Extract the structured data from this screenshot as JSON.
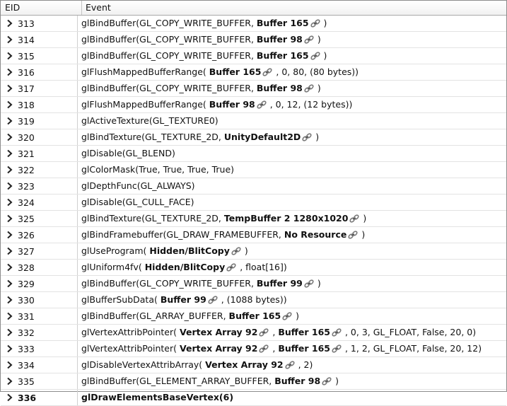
{
  "columns": {
    "eid": "EID",
    "event": "Event"
  },
  "rows": [
    {
      "eid": "313",
      "parts": [
        {
          "t": "glBindBuffer(GL_COPY_WRITE_BUFFER, "
        },
        {
          "t": "Buffer 165",
          "b": true,
          "l": true
        },
        {
          "t": " )"
        }
      ]
    },
    {
      "eid": "314",
      "parts": [
        {
          "t": "glBindBuffer(GL_COPY_WRITE_BUFFER, "
        },
        {
          "t": "Buffer 98",
          "b": true,
          "l": true
        },
        {
          "t": " )"
        }
      ]
    },
    {
      "eid": "315",
      "parts": [
        {
          "t": "glBindBuffer(GL_COPY_WRITE_BUFFER, "
        },
        {
          "t": "Buffer 165",
          "b": true,
          "l": true
        },
        {
          "t": " )"
        }
      ]
    },
    {
      "eid": "316",
      "parts": [
        {
          "t": "glFlushMappedBufferRange( "
        },
        {
          "t": "Buffer 165",
          "b": true,
          "l": true
        },
        {
          "t": " , 0, 80, (80 bytes))"
        }
      ]
    },
    {
      "eid": "317",
      "parts": [
        {
          "t": "glBindBuffer(GL_COPY_WRITE_BUFFER, "
        },
        {
          "t": "Buffer 98",
          "b": true,
          "l": true
        },
        {
          "t": " )"
        }
      ]
    },
    {
      "eid": "318",
      "parts": [
        {
          "t": "glFlushMappedBufferRange( "
        },
        {
          "t": "Buffer 98",
          "b": true,
          "l": true
        },
        {
          "t": " , 0, 12, (12 bytes))"
        }
      ]
    },
    {
      "eid": "319",
      "parts": [
        {
          "t": "glActiveTexture(GL_TEXTURE0)"
        }
      ]
    },
    {
      "eid": "320",
      "parts": [
        {
          "t": "glBindTexture(GL_TEXTURE_2D, "
        },
        {
          "t": "UnityDefault2D",
          "b": true,
          "l": true
        },
        {
          "t": " )"
        }
      ]
    },
    {
      "eid": "321",
      "parts": [
        {
          "t": "glDisable(GL_BLEND)"
        }
      ]
    },
    {
      "eid": "322",
      "parts": [
        {
          "t": "glColorMask(True, True, True, True)"
        }
      ]
    },
    {
      "eid": "323",
      "parts": [
        {
          "t": "glDepthFunc(GL_ALWAYS)"
        }
      ]
    },
    {
      "eid": "324",
      "parts": [
        {
          "t": "glDisable(GL_CULL_FACE)"
        }
      ]
    },
    {
      "eid": "325",
      "parts": [
        {
          "t": "glBindTexture(GL_TEXTURE_2D, "
        },
        {
          "t": "TempBuffer 2 1280x1020",
          "b": true,
          "l": true
        },
        {
          "t": " )"
        }
      ]
    },
    {
      "eid": "326",
      "parts": [
        {
          "t": "glBindFramebuffer(GL_DRAW_FRAMEBUFFER, "
        },
        {
          "t": "No Resource",
          "b": true,
          "l": true
        },
        {
          "t": " )"
        }
      ]
    },
    {
      "eid": "327",
      "parts": [
        {
          "t": "glUseProgram( "
        },
        {
          "t": "Hidden/BlitCopy",
          "b": true,
          "l": true
        },
        {
          "t": " )"
        }
      ]
    },
    {
      "eid": "328",
      "parts": [
        {
          "t": "glUniform4fv( "
        },
        {
          "t": "Hidden/BlitCopy",
          "b": true,
          "l": true
        },
        {
          "t": " , float[16])"
        }
      ]
    },
    {
      "eid": "329",
      "parts": [
        {
          "t": "glBindBuffer(GL_COPY_WRITE_BUFFER, "
        },
        {
          "t": "Buffer 99",
          "b": true,
          "l": true
        },
        {
          "t": " )"
        }
      ]
    },
    {
      "eid": "330",
      "parts": [
        {
          "t": "glBufferSubData( "
        },
        {
          "t": "Buffer 99",
          "b": true,
          "l": true
        },
        {
          "t": " , (1088 bytes))"
        }
      ]
    },
    {
      "eid": "331",
      "parts": [
        {
          "t": "glBindBuffer(GL_ARRAY_BUFFER, "
        },
        {
          "t": "Buffer 165",
          "b": true,
          "l": true
        },
        {
          "t": " )"
        }
      ]
    },
    {
      "eid": "332",
      "parts": [
        {
          "t": "glVertexAttribPointer( "
        },
        {
          "t": "Vertex Array 92",
          "b": true,
          "l": true
        },
        {
          "t": " , "
        },
        {
          "t": "Buffer 165",
          "b": true,
          "l": true
        },
        {
          "t": " , 0, 3, GL_FLOAT, False, 20, 0)"
        }
      ]
    },
    {
      "eid": "333",
      "parts": [
        {
          "t": "glVertexAttribPointer( "
        },
        {
          "t": "Vertex Array 92",
          "b": true,
          "l": true
        },
        {
          "t": " , "
        },
        {
          "t": "Buffer 165",
          "b": true,
          "l": true
        },
        {
          "t": " , 1, 2, GL_FLOAT, False, 20, 12)"
        }
      ]
    },
    {
      "eid": "334",
      "parts": [
        {
          "t": "glDisableVertexAttribArray( "
        },
        {
          "t": "Vertex Array 92",
          "b": true,
          "l": true
        },
        {
          "t": " , 2)"
        }
      ]
    },
    {
      "eid": "335",
      "parts": [
        {
          "t": "glBindBuffer(GL_ELEMENT_ARRAY_BUFFER, "
        },
        {
          "t": "Buffer 98",
          "b": true,
          "l": true
        },
        {
          "t": " )"
        }
      ]
    },
    {
      "eid": "336",
      "selected": true,
      "parts": [
        {
          "t": "glDrawElementsBaseVertex(6)"
        }
      ]
    }
  ]
}
